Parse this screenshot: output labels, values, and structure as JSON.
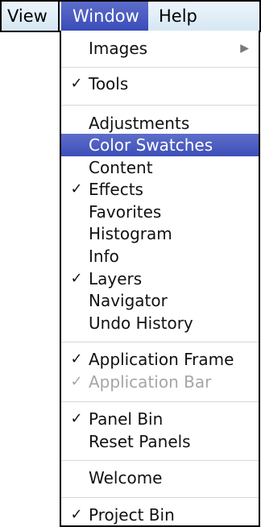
{
  "menubar": {
    "view": "View",
    "window": "Window",
    "help": "Help"
  },
  "window_menu": {
    "images": {
      "label": "Images",
      "submenu_icon": "submenu-arrow-icon",
      "arrow": "▶"
    },
    "tools": {
      "label": "Tools",
      "checked": true
    },
    "adjustments": {
      "label": "Adjustments",
      "checked": false
    },
    "color_swatches": {
      "label": "Color Swatches",
      "checked": false,
      "highlighted": true
    },
    "content": {
      "label": "Content",
      "checked": false
    },
    "effects": {
      "label": "Effects",
      "checked": true
    },
    "favorites": {
      "label": "Favorites",
      "checked": false
    },
    "histogram": {
      "label": "Histogram",
      "checked": false
    },
    "info": {
      "label": "Info",
      "checked": false
    },
    "layers": {
      "label": "Layers",
      "checked": true
    },
    "navigator": {
      "label": "Navigator",
      "checked": false
    },
    "undo_history": {
      "label": "Undo History",
      "checked": false
    },
    "application_frame": {
      "label": "Application Frame",
      "checked": true
    },
    "application_bar": {
      "label": "Application Bar",
      "checked": true,
      "disabled": true
    },
    "panel_bin": {
      "label": "Panel Bin",
      "checked": true
    },
    "reset_panels": {
      "label": "Reset Panels",
      "checked": false
    },
    "welcome": {
      "label": "Welcome",
      "checked": false
    },
    "project_bin": {
      "label": "Project Bin",
      "checked": true
    },
    "check_glyph": "✓"
  },
  "colors": {
    "highlight": "#3d4fb8",
    "menubar_bg": "#d6e7f4",
    "disabled_text": "#a6a6a6",
    "separator": "#d7d7d7"
  }
}
